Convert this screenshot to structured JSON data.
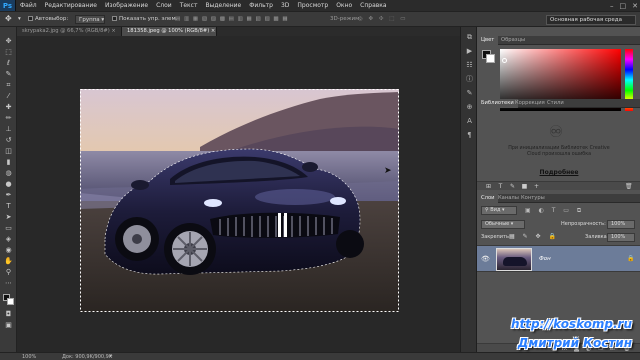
{
  "app": {
    "logo": "Ps"
  },
  "menu": [
    "Файл",
    "Редактирование",
    "Изображение",
    "Слои",
    "Текст",
    "Выделение",
    "Фильтр",
    "3D",
    "Просмотр",
    "Окно",
    "Справка"
  ],
  "window_controls": [
    "–",
    "□",
    "✕"
  ],
  "options": {
    "autoselect_label": "Автовыбор:",
    "autoselect_value": "Группа",
    "show_controls_label": "Показать упр. элем.",
    "mode_3d_label": "3D-режим:",
    "workspace": "Основная рабочая среда"
  },
  "tabs": [
    {
      "label": "skrypakа2.jpg @ 66,7% (RGB/8#) ×",
      "active": false
    },
    {
      "label": "181358.jpeg @ 100% (RGB/8#) ×",
      "active": true
    }
  ],
  "status": {
    "zoom": "100%",
    "doc_size": "Док: 900,9K/900,9K"
  },
  "panels": {
    "color_tabs": [
      "Цвет",
      "Образцы"
    ],
    "library_tabs": [
      "Библиотеки",
      "Коррекция",
      "Стили"
    ],
    "library_message": "При инициализации Библиотек Creative Cloud произошла ошибка",
    "library_link": "Подробнее",
    "layers_tabs": [
      "Слои",
      "Каналы",
      "Контуры"
    ],
    "kind_filter": "Вид",
    "blend_mode": "Обычные",
    "opacity_label": "Непрозрачность:",
    "opacity_value": "100%",
    "lock_label": "Закрепить:",
    "fill_label": "Заливка:",
    "fill_value": "100%",
    "layer_name": "Фон"
  },
  "watermark": {
    "line1": "http://koskomp.ru",
    "line2": "Дмитрий Костин"
  },
  "colors": {
    "accent": "#31a8ff",
    "watermark": "#2b7fff",
    "layer_selected": "#6c7c99"
  }
}
